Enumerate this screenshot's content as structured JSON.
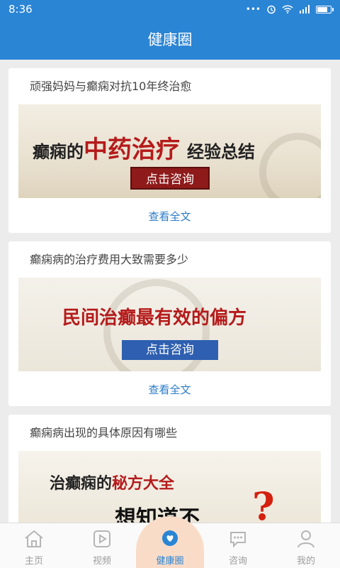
{
  "status": {
    "time": "8:36"
  },
  "header": {
    "title": "健康圈"
  },
  "articles": [
    {
      "title": "顽强妈妈与癫痫对抗10年终治愈",
      "banner_text_parts": [
        "癫痫的",
        "中药治疗",
        "经验总结"
      ],
      "banner_button": "点击咨询",
      "more_label": "查看全文"
    },
    {
      "title": "癫痫病的治疗费用大致需要多少",
      "banner_text_parts": [
        "民间治癫最有效的偏方"
      ],
      "banner_button": "点击咨询",
      "more_label": "查看全文"
    },
    {
      "title": "癫痫病出现的具体原因有哪些",
      "banner_text_parts": [
        "治癫痫的",
        "秘方大全",
        "想知道不",
        "?"
      ]
    }
  ],
  "tabs": [
    {
      "label": "主页",
      "icon": "home-icon"
    },
    {
      "label": "视频",
      "icon": "video-icon"
    },
    {
      "label": "健康圈",
      "icon": "heart-circle-icon",
      "active": true
    },
    {
      "label": "咨询",
      "icon": "chat-icon"
    },
    {
      "label": "我的",
      "icon": "person-icon"
    }
  ],
  "colors": {
    "primary": "#2b85d5",
    "link": "#2b7cc7",
    "accent_red": "#b51b1b"
  }
}
